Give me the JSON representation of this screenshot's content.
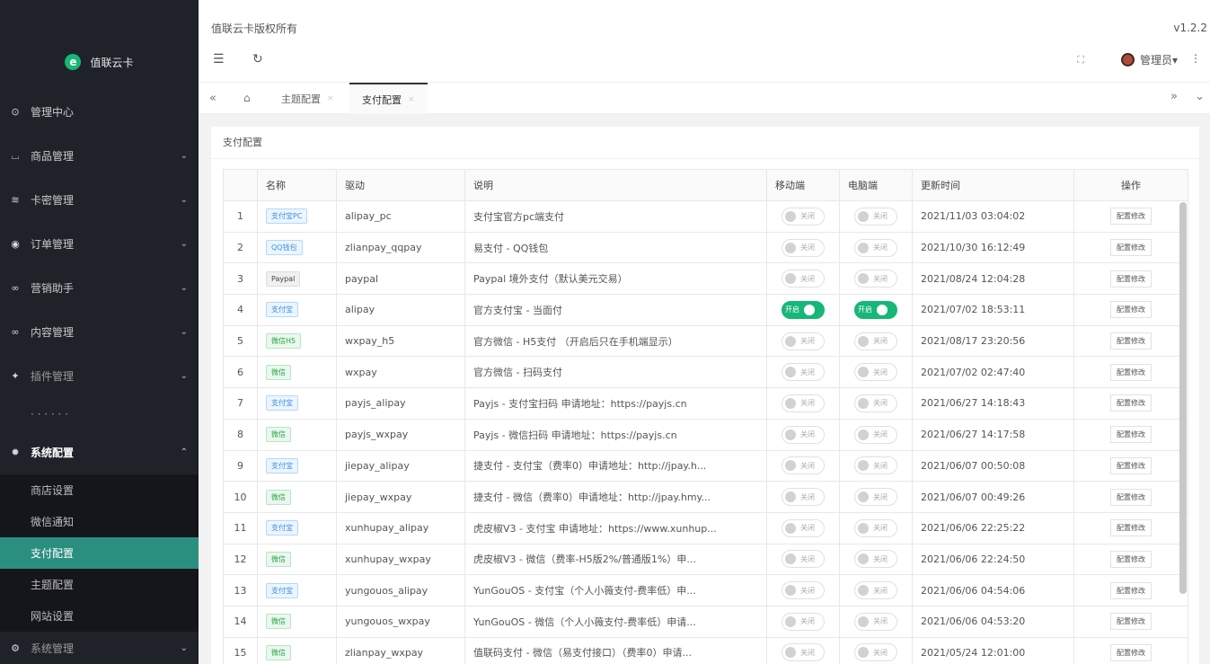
{
  "app": {
    "logo_letter": "e",
    "logo_text": "值联云卡",
    "copyright": "值联云卡版权所有",
    "version": "v1.2.2",
    "admin_label": "管理员▾",
    "menu_more": "⋮"
  },
  "sidebar": {
    "items": [
      {
        "icon": "dashboard-icon",
        "glyph": "⊙",
        "label": "管理中心",
        "arrow": ""
      },
      {
        "icon": "cart-icon",
        "glyph": "⌴",
        "label": "商品管理",
        "arrow": "⌄"
      },
      {
        "icon": "layers-icon",
        "glyph": "≋",
        "label": "卡密管理",
        "arrow": "⌄"
      },
      {
        "icon": "order-icon",
        "glyph": "◉",
        "label": "订单管理",
        "arrow": "⌄"
      },
      {
        "icon": "marketing-icon",
        "glyph": "∞",
        "label": "营销助手",
        "arrow": "⌄"
      },
      {
        "icon": "content-icon",
        "glyph": "∞",
        "label": "内容管理",
        "arrow": "⌄"
      },
      {
        "icon": "plugin-icon",
        "glyph": "✦",
        "label": "插件管理",
        "arrow": "⌄"
      },
      {
        "icon": "more-icon",
        "glyph": "",
        "label": "· · · · · ·",
        "arrow": ""
      },
      {
        "icon": "settings-icon",
        "glyph": "✹",
        "label": "系统配置",
        "arrow": "⌃"
      }
    ],
    "sub_items": [
      {
        "label": "商店设置"
      },
      {
        "label": "微信通知"
      },
      {
        "label": "支付配置"
      },
      {
        "label": "主题配置"
      },
      {
        "label": "网站设置"
      }
    ],
    "bottom_item": {
      "label": "系统管理",
      "arrow": "⌄"
    }
  },
  "tabs": [
    {
      "label": "主题配置",
      "close": "×"
    },
    {
      "label": "支付配置",
      "close": "×"
    }
  ],
  "card_title": "支付配置",
  "table": {
    "headers": [
      "",
      "名称",
      "驱动",
      "说明",
      "移动端",
      "电脑端",
      "更新时间",
      "操作"
    ],
    "switch_off": "关闭",
    "switch_on": "开启",
    "action_label": "配置修改",
    "rows": [
      {
        "id": "1",
        "name": "支付宝PC",
        "color": "blue",
        "driver": "alipay_pc",
        "desc": "支付宝官方pc端支付",
        "mobile": false,
        "pc": false,
        "time": "2021/11/03 03:04:02"
      },
      {
        "id": "2",
        "name": "QQ钱包",
        "color": "blue",
        "driver": "zlianpay_qqpay",
        "desc": "易支付 - QQ钱包",
        "mobile": false,
        "pc": false,
        "time": "2021/10/30 16:12:49"
      },
      {
        "id": "3",
        "name": "Paypal",
        "color": "gray",
        "driver": "paypal",
        "desc": "Paypal 境外支付（默认美元交易）",
        "mobile": false,
        "pc": false,
        "time": "2021/08/24 12:04:28"
      },
      {
        "id": "4",
        "name": "支付宝",
        "color": "blue",
        "driver": "alipay",
        "desc": "官方支付宝 - 当面付",
        "mobile": true,
        "pc": true,
        "time": "2021/07/02 18:53:11"
      },
      {
        "id": "5",
        "name": "微信H5",
        "color": "green",
        "driver": "wxpay_h5",
        "desc": "官方微信 - H5支付 （开启后只在手机端显示）",
        "mobile": false,
        "pc": false,
        "time": "2021/08/17 23:20:56"
      },
      {
        "id": "6",
        "name": "微信",
        "color": "green",
        "driver": "wxpay",
        "desc": "官方微信 - 扫码支付",
        "mobile": false,
        "pc": false,
        "time": "2021/07/02 02:47:40"
      },
      {
        "id": "7",
        "name": "支付宝",
        "color": "blue",
        "driver": "payjs_alipay",
        "desc": "Payjs - 支付宝扫码 申请地址：https://payjs.cn",
        "mobile": false,
        "pc": false,
        "time": "2021/06/27 14:18:43"
      },
      {
        "id": "8",
        "name": "微信",
        "color": "green",
        "driver": "payjs_wxpay",
        "desc": "Payjs - 微信扫码 申请地址：https://payjs.cn",
        "mobile": false,
        "pc": false,
        "time": "2021/06/27 14:17:58"
      },
      {
        "id": "9",
        "name": "支付宝",
        "color": "blue",
        "driver": "jiepay_alipay",
        "desc": "捷支付 - 支付宝（费率0）申请地址：http://jpay.h...",
        "mobile": false,
        "pc": false,
        "time": "2021/06/07 00:50:08"
      },
      {
        "id": "10",
        "name": "微信",
        "color": "green",
        "driver": "jiepay_wxpay",
        "desc": "捷支付 - 微信（费率0）申请地址：http://jpay.hmy...",
        "mobile": false,
        "pc": false,
        "time": "2021/06/07 00:49:26"
      },
      {
        "id": "11",
        "name": "支付宝",
        "color": "blue",
        "driver": "xunhupay_alipay",
        "desc": "虎皮椒V3 - 支付宝 申请地址：https://www.xunhup...",
        "mobile": false,
        "pc": false,
        "time": "2021/06/06 22:25:22"
      },
      {
        "id": "12",
        "name": "微信",
        "color": "green",
        "driver": "xunhupay_wxpay",
        "desc": "虎皮椒V3 - 微信（费率-H5版2%/普通版1%）申...",
        "mobile": false,
        "pc": false,
        "time": "2021/06/06 22:24:50"
      },
      {
        "id": "13",
        "name": "支付宝",
        "color": "blue",
        "driver": "yungouos_alipay",
        "desc": "YunGouOS - 支付宝（个人小薇支付-费率低）申...",
        "mobile": false,
        "pc": false,
        "time": "2021/06/06 04:54:06"
      },
      {
        "id": "14",
        "name": "微信",
        "color": "green",
        "driver": "yungouos_wxpay",
        "desc": "YunGouOS - 微信（个人小薇支付-费率低）申请...",
        "mobile": false,
        "pc": false,
        "time": "2021/06/06 04:53:20"
      },
      {
        "id": "15",
        "name": "微信",
        "color": "green",
        "driver": "zlianpay_wxpay",
        "desc": "值联码支付 - 微信（易支付接口）（费率0）申请...",
        "mobile": false,
        "pc": false,
        "time": "2021/05/24 12:01:00"
      }
    ]
  },
  "colors": {
    "accent": "#16b777",
    "sidebar_bg": "#20222a",
    "active_sub": "#2b8f7f"
  }
}
